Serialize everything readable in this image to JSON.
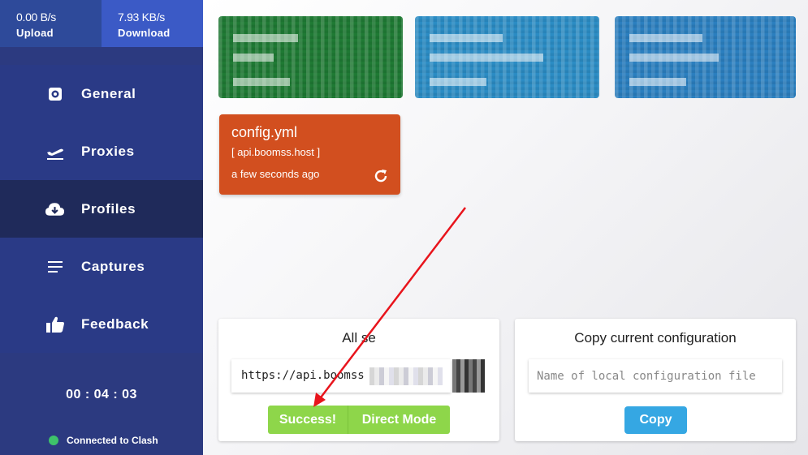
{
  "traffic": {
    "upload_value": "0.00 B/s",
    "upload_label": "Upload",
    "download_value": "7.93 KB/s",
    "download_label": "Download"
  },
  "nav": {
    "items": [
      {
        "label": "General",
        "icon": "gear-icon"
      },
      {
        "label": "Proxies",
        "icon": "plane-icon"
      },
      {
        "label": "Profiles",
        "icon": "cloud-download-icon"
      },
      {
        "label": "Captures",
        "icon": "list-icon"
      },
      {
        "label": "Feedback",
        "icon": "thumbs-up-icon"
      }
    ],
    "active": "Profiles"
  },
  "status": {
    "timer": "00 : 04 : 03",
    "connection": "Connected to Clash",
    "connection_color": "#3ec26a"
  },
  "profiles": {
    "active": {
      "name": "config.yml",
      "host": "[ api.boomss.host ]",
      "updated": "a few seconds ago",
      "color": "#d24f1f"
    },
    "others_colors": [
      "#1f7a34",
      "#2b8cc4",
      "#2b7fbf"
    ]
  },
  "import_panel": {
    "title": "All se",
    "url_value": "https://api.boomss",
    "success_label": "Success!",
    "direct_label": "Direct Mode",
    "button_color": "#8ed64a"
  },
  "copy_panel": {
    "title": "Copy current configuration",
    "placeholder": "Name of local configuration file",
    "copy_label": "Copy",
    "button_color": "#35a7e3"
  },
  "annotation_color": "#e8141c"
}
